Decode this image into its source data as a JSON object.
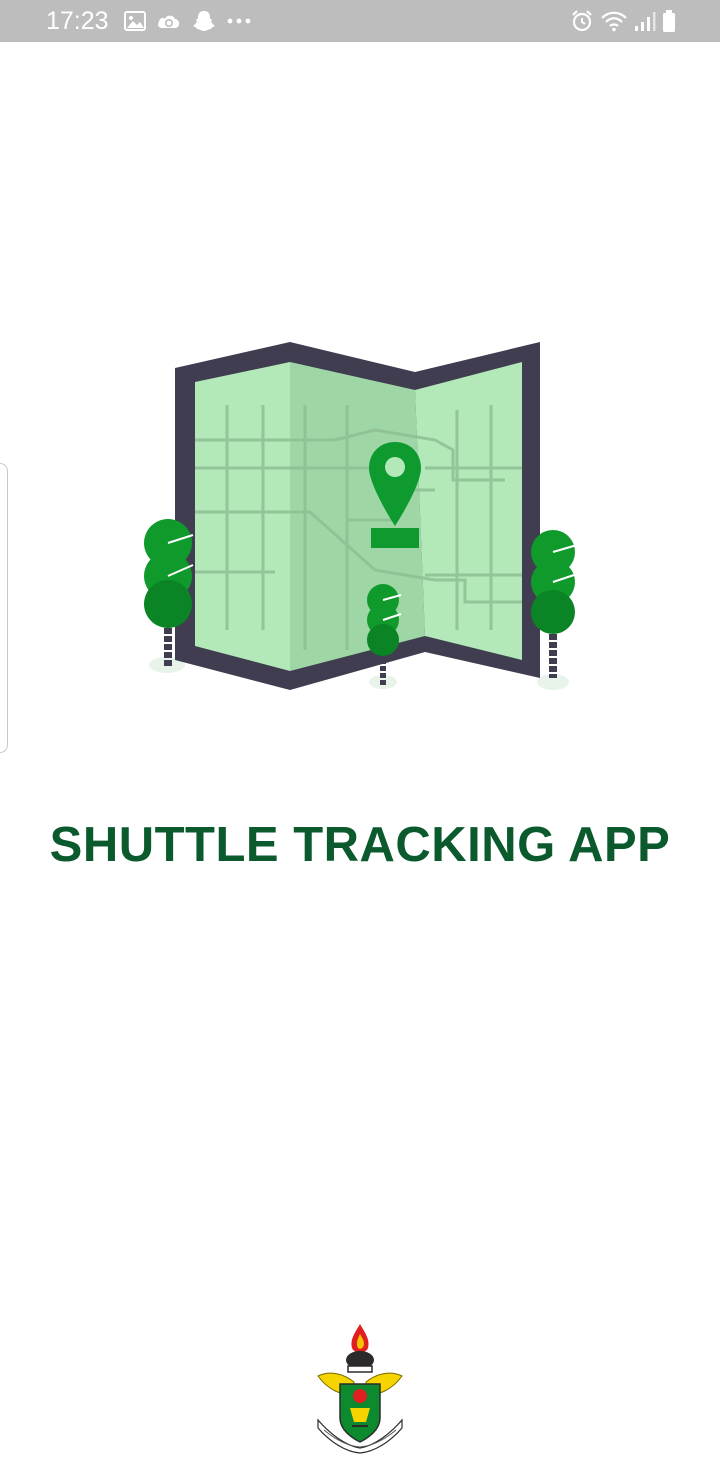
{
  "status_bar": {
    "time": "17:23",
    "left_icons": [
      "gallery-icon",
      "cloud-sync-icon",
      "snapchat-icon",
      "more-dots-icon"
    ],
    "right_icons": [
      "alarm-icon",
      "wifi-icon",
      "signal-icon",
      "battery-icon"
    ]
  },
  "splash": {
    "title": "SHUTTLE TRACKING APP",
    "illustration": "map-with-location-pin",
    "logo": "university-crest"
  },
  "colors": {
    "status_bar_bg": "#bdbdbd",
    "title_green": "#0b5a2e",
    "map_light_green": "#b3e8b9",
    "map_mid_green": "#9fd6a6",
    "map_border": "#3f3d4f",
    "pin_green": "#0e9a2e",
    "tree_green": "#119a2c",
    "tree_dark": "#0a7a20"
  }
}
